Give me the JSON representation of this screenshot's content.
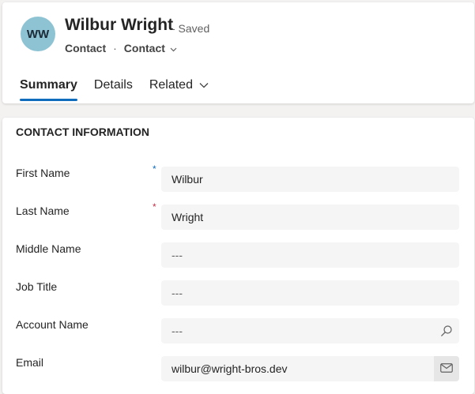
{
  "record": {
    "initials": "WW",
    "name": "Wilbur Wright",
    "status": "- Saved",
    "entity": "Contact",
    "separator": "·",
    "form": "Contact"
  },
  "tabs": [
    {
      "label": "Summary"
    },
    {
      "label": "Details"
    },
    {
      "label": "Related"
    }
  ],
  "section": {
    "title": "CONTACT INFORMATION",
    "fields": [
      {
        "label": "First Name",
        "value": "Wilbur",
        "required_marker": "*"
      },
      {
        "label": "Last Name",
        "value": "Wright",
        "required_marker": "*"
      },
      {
        "label": "Middle Name",
        "value": "---"
      },
      {
        "label": "Job Title",
        "value": "---"
      },
      {
        "label": "Account Name",
        "value": "---"
      },
      {
        "label": "Email",
        "value": "wilbur@wright-bros.dev"
      }
    ]
  },
  "icons": {
    "form_selector": "chevron-down-icon",
    "related_tab": "chevron-down-icon",
    "account_lookup": "search-icon",
    "email_action": "mail-icon"
  },
  "colors": {
    "avatar_bg": "#8dc3d3",
    "accent": "#0f6cbd",
    "recommended_marker": "#0f6cbd",
    "required_marker": "#c4314b",
    "input_bg": "#f5f5f5",
    "page_bg": "#f3f2f1"
  }
}
